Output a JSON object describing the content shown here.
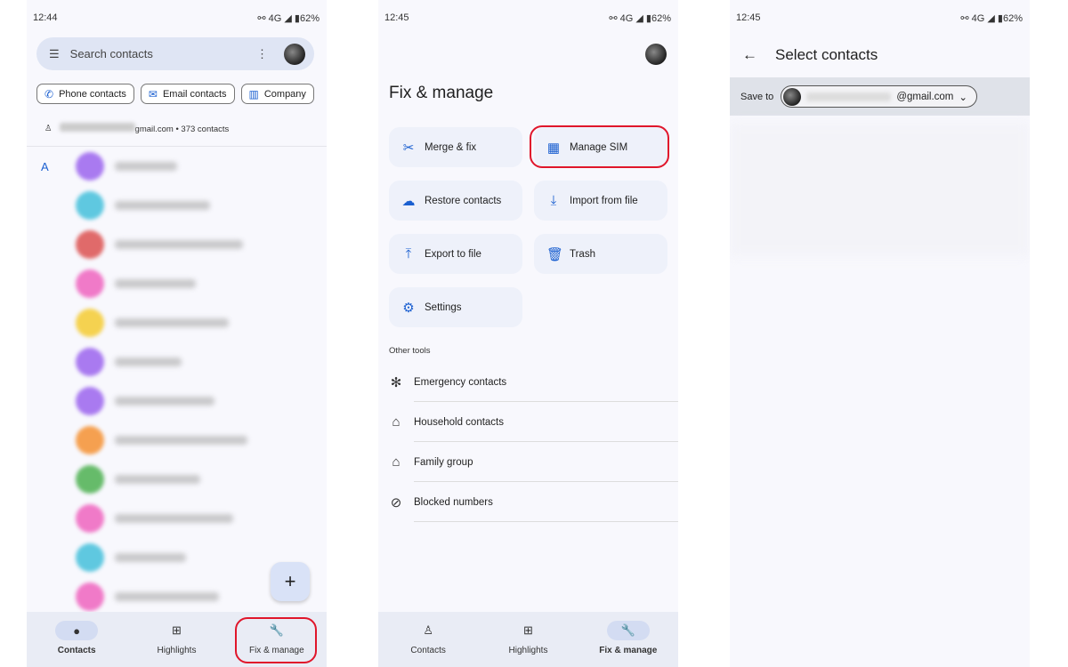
{
  "screens": [
    {
      "status": {
        "time": "12:44",
        "battery": "62%"
      },
      "search": {
        "placeholder": "Search contacts"
      },
      "chips": [
        {
          "label": "Phone contacts",
          "icon": "phone-icon"
        },
        {
          "label": "Email contacts",
          "icon": "mail-icon"
        },
        {
          "label": "Company",
          "icon": "building-icon"
        }
      ],
      "account": {
        "suffix": "gmail.com • 373 contacts"
      },
      "section_letter": "A",
      "avatar_colors": [
        "#a97af0",
        "#5fc8e0",
        "#e06a6a",
        "#f07ac8",
        "#f5d250",
        "#a97af0",
        "#a97af0",
        "#f5a050",
        "#66bb6a",
        "#f07ac8",
        "#5fc8e0",
        "#f07ac8"
      ],
      "fab": "+",
      "nav": [
        {
          "label": "Contacts",
          "icon": "person-icon",
          "active": true
        },
        {
          "label": "Highlights",
          "icon": "highlights-icon"
        },
        {
          "label": "Fix & manage",
          "icon": "wrench-icon"
        }
      ]
    },
    {
      "status": {
        "time": "12:45",
        "battery": "62%"
      },
      "title": "Fix & manage",
      "tiles": [
        {
          "label": "Merge & fix",
          "icon": "✂"
        },
        {
          "label": "Manage SIM",
          "icon": "▦"
        },
        {
          "label": "Restore contacts",
          "icon": "☁"
        },
        {
          "label": "Import from file",
          "icon": "⤓"
        },
        {
          "label": "Export to file",
          "icon": "⤒"
        },
        {
          "label": "Trash",
          "icon": "🗑"
        },
        {
          "label": "Settings",
          "icon": "⚙"
        }
      ],
      "other_tools_label": "Other tools",
      "other_tools": [
        {
          "label": "Emergency contacts",
          "icon": "✻"
        },
        {
          "label": "Household contacts",
          "icon": "⌂"
        },
        {
          "label": "Family group",
          "icon": "⌂"
        },
        {
          "label": "Blocked numbers",
          "icon": "⊘"
        }
      ],
      "nav": [
        {
          "label": "Contacts",
          "icon": "person-icon"
        },
        {
          "label": "Highlights",
          "icon": "highlights-icon"
        },
        {
          "label": "Fix & manage",
          "icon": "wrench-icon",
          "active": true
        }
      ]
    },
    {
      "status": {
        "time": "12:45",
        "battery": "62%"
      },
      "title": "Select contacts",
      "save_to_label": "Save to",
      "account_suffix": "@gmail.com"
    }
  ],
  "highlight_color": "#e0162b"
}
